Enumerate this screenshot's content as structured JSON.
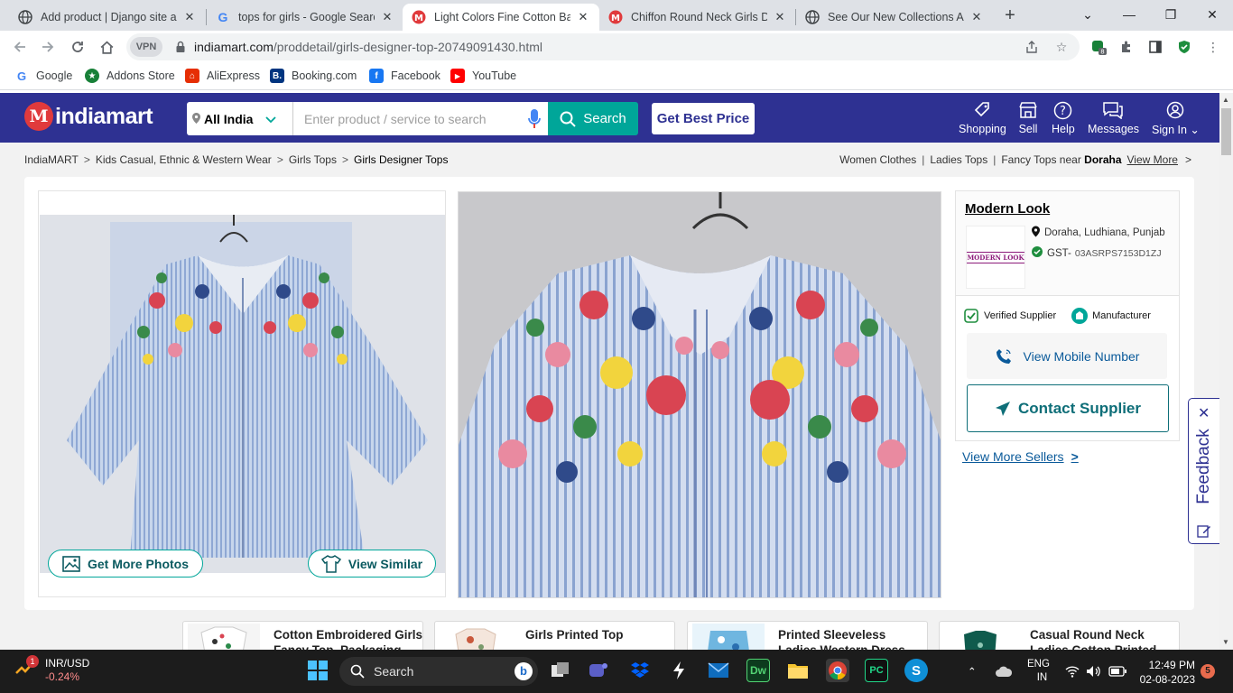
{
  "browser": {
    "tabs": [
      {
        "title": "Add product | Django site ad",
        "favicon": "globe-icon"
      },
      {
        "title": "tops for girls - Google Search",
        "favicon": "google-icon"
      },
      {
        "title": "Light Colors Fine Cotton Base",
        "favicon": "indiamart-icon"
      },
      {
        "title": "Chiffon Round Neck Girls De",
        "favicon": "indiamart-icon"
      },
      {
        "title": "See Our New Collections ABC",
        "favicon": "globe-icon"
      }
    ],
    "vpn_label": "VPN",
    "url_host": "indiamart.com",
    "url_path": "/proddetail/girls-designer-top-20749091430.html",
    "extension_badge": "8",
    "bookmarks": [
      "Google",
      "Addons Store",
      "AliExpress",
      "Booking.com",
      "Facebook",
      "YouTube"
    ]
  },
  "header": {
    "logo_text": "indiamart",
    "logo_letter": "M",
    "location": "All India",
    "search_placeholder": "Enter product / service to search",
    "search_button": "Search",
    "best_price_button": "Get Best Price",
    "nav": [
      "Shopping",
      "Sell",
      "Help",
      "Messages",
      "Sign In"
    ]
  },
  "breadcrumb": [
    "IndiaMART",
    "Kids Casual, Ethnic & Western Wear",
    "Girls Tops",
    "Girls Designer Tops"
  ],
  "related_links": {
    "items": [
      "Women Clothes",
      "Ladies Tops"
    ],
    "near_prefix": "Fancy Tops near",
    "near_place": "Doraha",
    "view_more": "View More"
  },
  "gallery": {
    "get_more_photos": "Get More Photos",
    "view_similar": "View Similar"
  },
  "seller": {
    "name": "Modern Look",
    "logo_text": "MODERN LOOK",
    "location": "Doraha, Ludhiana, Punjab",
    "gst_label": "GST-",
    "gst_number": "03ASRPS7153D1ZJ",
    "verified": "Verified Supplier",
    "type": "Manufacturer",
    "view_mobile": "View Mobile Number",
    "contact": "Contact Supplier",
    "view_more_sellers": "View More Sellers"
  },
  "feedback_label": "Feedback",
  "related_products": [
    "Cotton Embroidered Girls Fancy Top, Packaging",
    "Girls Printed Top",
    "Printed Sleeveless Ladies Western Dress",
    "Casual Round Neck Ladies Cotton Printed"
  ],
  "taskbar": {
    "ticker_label": "INR/USD",
    "ticker_value": "-0.24%",
    "ticker_badge": "1",
    "search_label": "Search",
    "lang_top": "ENG",
    "lang_bottom": "IN",
    "time": "12:49 PM",
    "date": "02-08-2023",
    "notification_count": "5"
  },
  "colors": {
    "brand_navy": "#2e3192",
    "brand_teal": "#00a699",
    "contact_teal": "#0e6e78"
  }
}
